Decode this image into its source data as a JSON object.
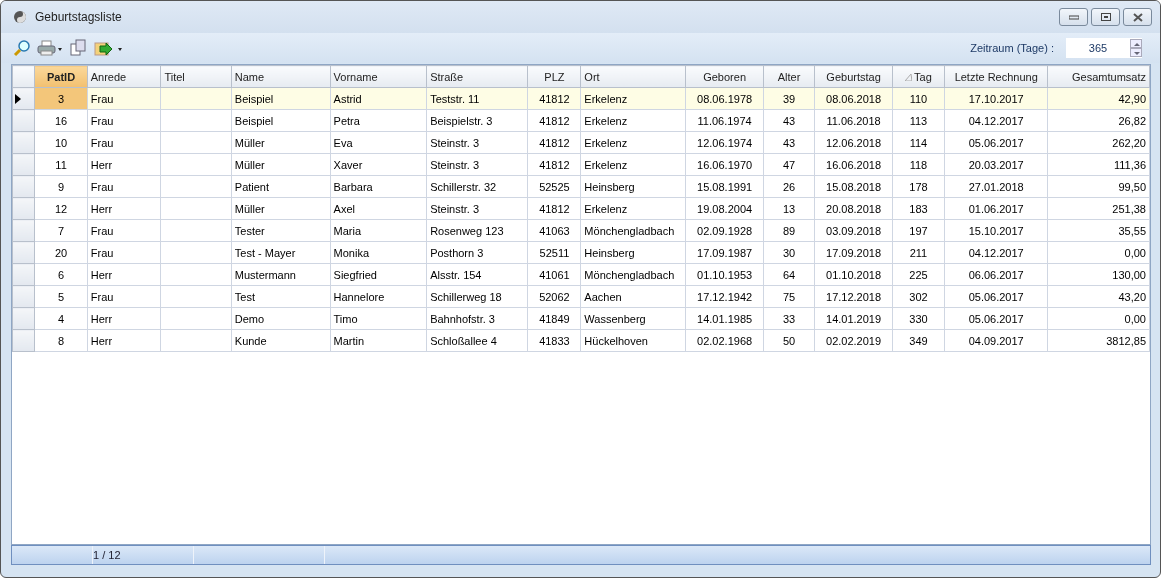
{
  "window": {
    "title": "Geburtstagsliste"
  },
  "toolbar": {
    "period_label": "Zeitraum (Tage) :",
    "period_value": "365"
  },
  "table": {
    "columns": [
      {
        "label": "PatID",
        "selected": true,
        "sorted": false
      },
      {
        "label": "Anrede",
        "selected": false,
        "sorted": false
      },
      {
        "label": "Titel",
        "selected": false,
        "sorted": false
      },
      {
        "label": "Name",
        "selected": false,
        "sorted": false
      },
      {
        "label": "Vorname",
        "selected": false,
        "sorted": false
      },
      {
        "label": "Straße",
        "selected": false,
        "sorted": false
      },
      {
        "label": "PLZ",
        "selected": false,
        "sorted": false
      },
      {
        "label": "Ort",
        "selected": false,
        "sorted": false
      },
      {
        "label": "Geboren",
        "selected": false,
        "sorted": false
      },
      {
        "label": "Alter",
        "selected": false,
        "sorted": false
      },
      {
        "label": "Geburtstag",
        "selected": false,
        "sorted": false
      },
      {
        "label": "Tag",
        "selected": false,
        "sorted": true
      },
      {
        "label": "Letzte Rechnung",
        "selected": false,
        "sorted": false
      },
      {
        "label": "Gesamtumsatz",
        "selected": false,
        "sorted": false
      }
    ],
    "rows": [
      {
        "selected": true,
        "cells": [
          "3",
          "Frau",
          "",
          "Beispiel",
          "Astrid",
          "Teststr. 11",
          "41812",
          "Erkelenz",
          "08.06.1978",
          "39",
          "08.06.2018",
          "110",
          "17.10.2017",
          "42,90"
        ]
      },
      {
        "selected": false,
        "cells": [
          "16",
          "Frau",
          "",
          "Beispiel",
          "Petra",
          "Beispielstr. 3",
          "41812",
          "Erkelenz",
          "11.06.1974",
          "43",
          "11.06.2018",
          "113",
          "04.12.2017",
          "26,82"
        ]
      },
      {
        "selected": false,
        "cells": [
          "10",
          "Frau",
          "",
          "Müller",
          "Eva",
          "Steinstr. 3",
          "41812",
          "Erkelenz",
          "12.06.1974",
          "43",
          "12.06.2018",
          "114",
          "05.06.2017",
          "262,20"
        ]
      },
      {
        "selected": false,
        "cells": [
          "11",
          "Herr",
          "",
          "Müller",
          "Xaver",
          "Steinstr. 3",
          "41812",
          "Erkelenz",
          "16.06.1970",
          "47",
          "16.06.2018",
          "118",
          "20.03.2017",
          "111,36"
        ]
      },
      {
        "selected": false,
        "cells": [
          "9",
          "Frau",
          "",
          "Patient",
          "Barbara",
          "Schillerstr. 32",
          "52525",
          "Heinsberg",
          "15.08.1991",
          "26",
          "15.08.2018",
          "178",
          "27.01.2018",
          "99,50"
        ]
      },
      {
        "selected": false,
        "cells": [
          "12",
          "Herr",
          "",
          "Müller",
          "Axel",
          "Steinstr. 3",
          "41812",
          "Erkelenz",
          "19.08.2004",
          "13",
          "20.08.2018",
          "183",
          "01.06.2017",
          "251,38"
        ]
      },
      {
        "selected": false,
        "cells": [
          "7",
          "Frau",
          "",
          "Tester",
          "Maria",
          "Rosenweg 123",
          "41063",
          "Mönchengladbach",
          "02.09.1928",
          "89",
          "03.09.2018",
          "197",
          "15.10.2017",
          "35,55"
        ]
      },
      {
        "selected": false,
        "cells": [
          "20",
          "Frau",
          "",
          "Test - Mayer",
          "Monika",
          "Posthorn 3",
          "52511",
          "Heinsberg",
          "17.09.1987",
          "30",
          "17.09.2018",
          "211",
          "04.12.2017",
          "0,00"
        ]
      },
      {
        "selected": false,
        "cells": [
          "6",
          "Herr",
          "",
          "Mustermann",
          "Siegfried",
          "Alsstr. 154",
          "41061",
          "Mönchengladbach",
          "01.10.1953",
          "64",
          "01.10.2018",
          "225",
          "06.06.2017",
          "130,00"
        ]
      },
      {
        "selected": false,
        "cells": [
          "5",
          "Frau",
          "",
          "Test",
          "Hannelore",
          "Schillerweg 18",
          "52062",
          "Aachen",
          "17.12.1942",
          "75",
          "17.12.2018",
          "302",
          "05.06.2017",
          "43,20"
        ]
      },
      {
        "selected": false,
        "cells": [
          "4",
          "Herr",
          "",
          "Demo",
          "Timo",
          "Bahnhofstr. 3",
          "41849",
          "Wassenberg",
          "14.01.1985",
          "33",
          "14.01.2019",
          "330",
          "05.06.2017",
          "0,00"
        ]
      },
      {
        "selected": false,
        "cells": [
          "8",
          "Herr",
          "",
          "Kunde",
          "Martin",
          "Schloßallee 4",
          "41833",
          "Hückelhoven",
          "02.02.1968",
          "50",
          "02.02.2019",
          "349",
          "04.09.2017",
          "3812,85"
        ]
      }
    ]
  },
  "status_bar": {
    "record": "1 / 12"
  }
}
